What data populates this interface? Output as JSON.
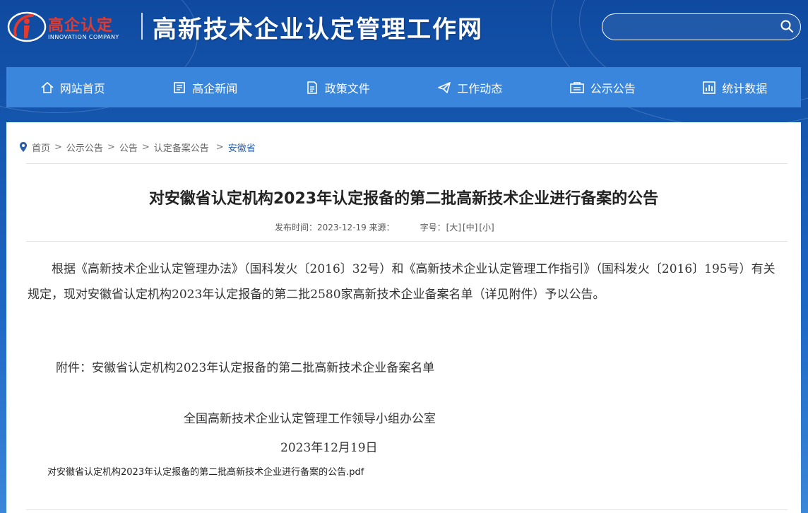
{
  "site": {
    "logo_text": "高企认定",
    "logo_sub": "INNOVATION COMPANY",
    "title": "高新技术企业认定管理工作网"
  },
  "search": {
    "placeholder": "",
    "icon": "search-icon"
  },
  "nav": {
    "items": [
      {
        "label": "网站首页",
        "icon": "home-icon"
      },
      {
        "label": "高企新闻",
        "icon": "news-icon"
      },
      {
        "label": "政策文件",
        "icon": "document-icon"
      },
      {
        "label": "工作动态",
        "icon": "paper-plane-icon"
      },
      {
        "label": "公示公告",
        "icon": "notice-icon"
      },
      {
        "label": "统计数据",
        "icon": "chart-icon"
      }
    ]
  },
  "breadcrumb": {
    "icon": "location-pin-icon",
    "items": [
      "首页",
      "公示公告",
      "公告",
      "认定备案公告"
    ],
    "separator": ">",
    "current": "安徽省"
  },
  "article": {
    "title": "对安徽省认定机构2023年认定报备的第二批高新技术企业进行备案的公告",
    "meta": {
      "published_label": "发布时间：2023-12-19 来源：",
      "font_size_label": "字号：",
      "sizes": [
        "[大]",
        "[中]",
        "[小]"
      ]
    },
    "body": "根据《高新技术企业认定管理办法》（国科发火〔2016〕32号）和《高新技术企业认定管理工作指引》（国科发火〔2016〕195号）有关规定，现对安徽省认定机构2023年认定报备的第二批2580家高新技术企业备案名单（详见附件）予以公告。",
    "attachment_line": "附件：安徽省认定机构2023年认定报备的第二批高新技术企业备案名单",
    "signature_org": "全国高新技术企业认定管理工作领导小组办公室",
    "signature_date": "2023年12月19日",
    "pdf_link": "对安徽省认定机构2023年认定报备的第二批高新技术企业进行备案的公告.pdf"
  },
  "colors": {
    "header_bg": "#1d67c4",
    "nav_bg": "#3b86dd",
    "logo_red": "#e23a2e",
    "breadcrumb_current": "#2a5fa8"
  }
}
